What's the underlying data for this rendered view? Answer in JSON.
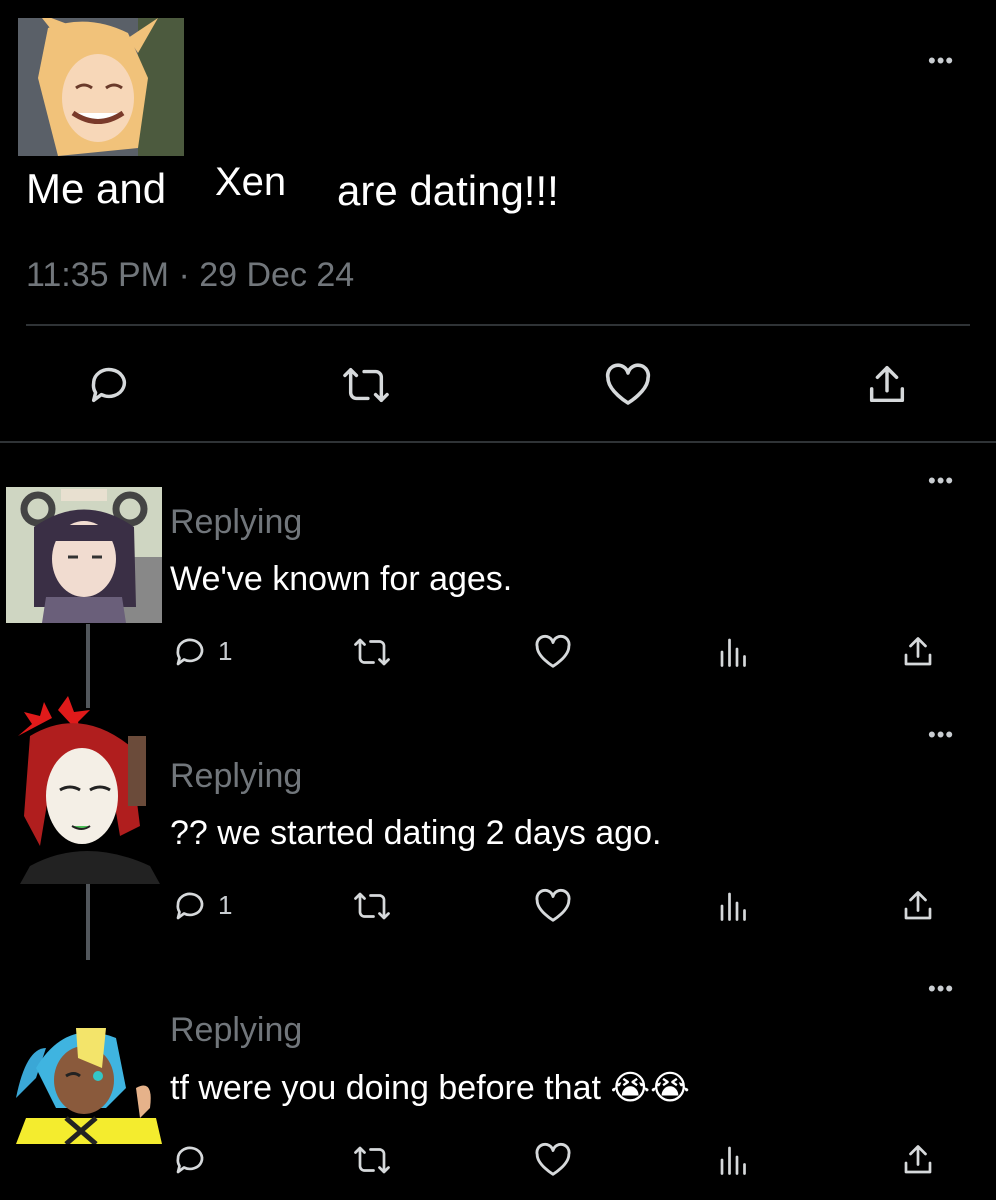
{
  "main_post": {
    "text_part1": "Me and",
    "mention": "Xen",
    "text_part2": "are dating!!!",
    "timestamp": "11:35 PM · 29 Dec 24",
    "more": "•••"
  },
  "replies": [
    {
      "label": "Replying",
      "text": "We've known for ages.",
      "reply_count": "1",
      "more": "•••"
    },
    {
      "label": "Replying",
      "text": "?? we started dating 2 days ago.",
      "reply_count": "1",
      "more": "•••"
    },
    {
      "label": "Replying",
      "text": "tf were you doing before that",
      "emoji": "😭😭",
      "reply_count": "",
      "more": "•••"
    }
  ],
  "colors": {
    "background": "#000000",
    "muted_text": "#71767b",
    "divider": "#2f3336",
    "icon": "#d6d9db"
  },
  "icons": [
    "reply-icon",
    "retweet-icon",
    "like-icon",
    "views-icon",
    "share-icon",
    "more-icon"
  ]
}
